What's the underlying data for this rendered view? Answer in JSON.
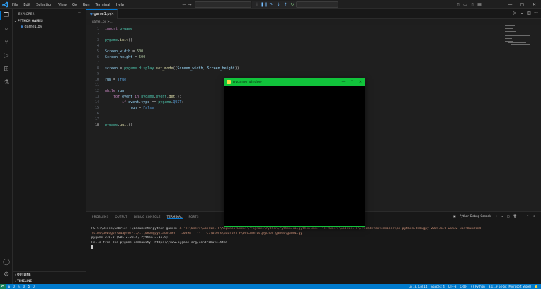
{
  "menu": [
    "File",
    "Edit",
    "Selection",
    "View",
    "Go",
    "Run",
    "Terminal",
    "Help"
  ],
  "sidebar": {
    "title": "EXPLORER",
    "folder": "PYTHON GAMES",
    "file": "game1.py",
    "outline": "OUTLINE",
    "timeline": "TIMELINE"
  },
  "editor": {
    "tab_label": "game1.py",
    "breadcrumb": "game1.py > ...",
    "current_line": 18
  },
  "code_lines": [
    [
      {
        "t": "import",
        "c": "kw"
      },
      {
        "t": " "
      },
      {
        "t": "pygame",
        "c": "mod"
      }
    ],
    [],
    [
      {
        "t": "pygame",
        "c": "mod"
      },
      {
        "t": "."
      },
      {
        "t": "init",
        "c": "fn"
      },
      {
        "t": "()"
      }
    ],
    [],
    [
      {
        "t": "Screen_width",
        "c": "var"
      },
      {
        "t": " = "
      },
      {
        "t": "500",
        "c": "num"
      }
    ],
    [
      {
        "t": "Screen_height",
        "c": "var"
      },
      {
        "t": " = "
      },
      {
        "t": "500",
        "c": "num"
      }
    ],
    [],
    [
      {
        "t": "screen",
        "c": "var"
      },
      {
        "t": " = "
      },
      {
        "t": "pygame",
        "c": "mod"
      },
      {
        "t": "."
      },
      {
        "t": "display",
        "c": "mod"
      },
      {
        "t": "."
      },
      {
        "t": "set_mode",
        "c": "fn"
      },
      {
        "t": "(("
      },
      {
        "t": "Screen_width",
        "c": "var"
      },
      {
        "t": ", "
      },
      {
        "t": "Screen_height",
        "c": "var"
      },
      {
        "t": "))"
      }
    ],
    [],
    [
      {
        "t": "run",
        "c": "var"
      },
      {
        "t": " = "
      },
      {
        "t": "True",
        "c": "cst"
      }
    ],
    [],
    [
      {
        "t": "while",
        "c": "kw"
      },
      {
        "t": " "
      },
      {
        "t": "run",
        "c": "var"
      },
      {
        "t": ":"
      }
    ],
    [
      {
        "t": "    "
      },
      {
        "t": "for",
        "c": "kw"
      },
      {
        "t": " "
      },
      {
        "t": "event",
        "c": "var"
      },
      {
        "t": " "
      },
      {
        "t": "in",
        "c": "kw"
      },
      {
        "t": " "
      },
      {
        "t": "pygame",
        "c": "mod"
      },
      {
        "t": "."
      },
      {
        "t": "event",
        "c": "mod"
      },
      {
        "t": "."
      },
      {
        "t": "get",
        "c": "fn"
      },
      {
        "t": "():"
      }
    ],
    [
      {
        "t": "        "
      },
      {
        "t": "if",
        "c": "kw"
      },
      {
        "t": " "
      },
      {
        "t": "event",
        "c": "var"
      },
      {
        "t": "."
      },
      {
        "t": "type",
        "c": "var"
      },
      {
        "t": " == "
      },
      {
        "t": "pygame",
        "c": "mod"
      },
      {
        "t": "."
      },
      {
        "t": "QUIT",
        "c": "cst"
      },
      {
        "t": ":"
      }
    ],
    [
      {
        "t": "            "
      },
      {
        "t": "run",
        "c": "var"
      },
      {
        "t": " = "
      },
      {
        "t": "False",
        "c": "cst"
      }
    ],
    [],
    [],
    [
      {
        "t": "pygame",
        "c": "mod"
      },
      {
        "t": "."
      },
      {
        "t": "quit",
        "c": "fn"
      },
      {
        "t": "()"
      }
    ]
  ],
  "panel": {
    "tabs": [
      "PROBLEMS",
      "OUTPUT",
      "DEBUG CONSOLE",
      "TERMINAL",
      "PORTS"
    ],
    "active_tab": "TERMINAL",
    "session_label": "Python Debug Console",
    "terminal": {
      "prompt": "PS C:\\Users\\Gabriel F\\Documents\\python games>",
      "command": " & 'c:\\Users\\Gabriel F\\AppData\\Local\\Programs\\Python\\Python311\\python.exe' 'c:\\Users\\Gabriel F\\.vscode\\extensions\\ms-python.debugpy-2024.6.0-win32-x64\\bundled",
      "command_cont": "\\libs\\debugpy\\adapter/../..\\debugpy\\launcher' '50898' '--' 'C:\\Users\\Gabriel F\\Documents\\python games\\game1.py'",
      "line_pygame": "pygame 2.6.0 (SDL 2.28.4, Python 3.11.9)",
      "line_hello": "Hello from the pygame community. https://www.pygame.org/contribute.html"
    }
  },
  "pygame_window": {
    "title": "pygame window"
  },
  "status": {
    "left": [
      "0",
      "0",
      "0"
    ],
    "right": [
      "Ln 18, Col 14",
      "Spaces: 4",
      "UTF-8",
      "CRLF",
      "{} Python",
      "3.11.9 64-bit (Microsoft Store)"
    ]
  }
}
